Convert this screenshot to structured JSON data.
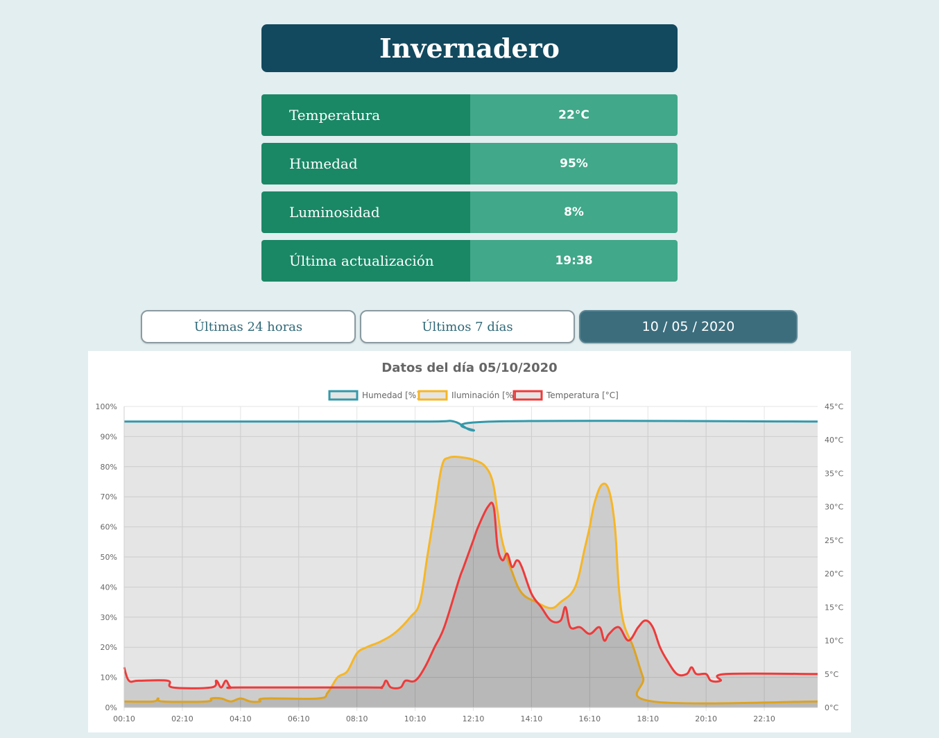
{
  "header": {
    "title": "Invernadero"
  },
  "stats": [
    {
      "label": "Temperatura",
      "value": "22°C"
    },
    {
      "label": "Humedad",
      "value": "95%"
    },
    {
      "label": "Luminosidad",
      "value": "8%"
    },
    {
      "label": "Última actualización",
      "value": "19:38"
    }
  ],
  "range_buttons": {
    "last_24h": "Últimas 24 horas",
    "last_7d": "Últimos 7 días",
    "date": "10 / 05 / 2020"
  },
  "colors": {
    "humidity": "#3399aa",
    "illumination": "#f6b626",
    "temperature": "#ee3a3a"
  },
  "chart_data": {
    "type": "line",
    "title": "Datos del día 05/10/2020",
    "legend_position": "top",
    "grid": true,
    "x_ticks": [
      "00:10",
      "02:10",
      "04:10",
      "06:10",
      "08:10",
      "10:10",
      "12:10",
      "14:10",
      "16:10",
      "18:10",
      "20:10",
      "22:10"
    ],
    "y_left": {
      "ticks": [
        "0%",
        "10%",
        "20%",
        "30%",
        "40%",
        "50%",
        "60%",
        "70%",
        "80%",
        "90%",
        "100%"
      ],
      "range": [
        0,
        100
      ]
    },
    "y_right": {
      "ticks": [
        "0°C",
        "5°C",
        "10°C",
        "15°C",
        "20°C",
        "25°C",
        "30°C",
        "35°C",
        "40°C",
        "45°C"
      ],
      "range": [
        0,
        45
      ]
    },
    "series": [
      {
        "name": "Humedad [%]",
        "axis": "left",
        "points": [
          [
            0,
            95
          ],
          [
            360,
            95
          ],
          [
            630,
            95
          ],
          [
            680,
            95
          ],
          [
            720,
            92
          ],
          [
            760,
            95
          ],
          [
            1430,
            95
          ]
        ]
      },
      {
        "name": "Iluminación [%]",
        "axis": "left",
        "points": [
          [
            0,
            2
          ],
          [
            60,
            2
          ],
          [
            70,
            3
          ],
          [
            80,
            2
          ],
          [
            170,
            2
          ],
          [
            180,
            3
          ],
          [
            200,
            3
          ],
          [
            220,
            2
          ],
          [
            240,
            3
          ],
          [
            260,
            2
          ],
          [
            280,
            2
          ],
          [
            290,
            3
          ],
          [
            400,
            3
          ],
          [
            420,
            5
          ],
          [
            440,
            10
          ],
          [
            460,
            12
          ],
          [
            480,
            18
          ],
          [
            500,
            20
          ],
          [
            530,
            22
          ],
          [
            560,
            25
          ],
          [
            590,
            30
          ],
          [
            610,
            35
          ],
          [
            625,
            50
          ],
          [
            640,
            65
          ],
          [
            655,
            80
          ],
          [
            670,
            83
          ],
          [
            700,
            83
          ],
          [
            725,
            82
          ],
          [
            745,
            80
          ],
          [
            760,
            75
          ],
          [
            770,
            65
          ],
          [
            780,
            55
          ],
          [
            800,
            45
          ],
          [
            820,
            38
          ],
          [
            850,
            35
          ],
          [
            880,
            33
          ],
          [
            900,
            35
          ],
          [
            930,
            40
          ],
          [
            950,
            53
          ],
          [
            960,
            60
          ],
          [
            970,
            68
          ],
          [
            985,
            74
          ],
          [
            1000,
            72
          ],
          [
            1012,
            60
          ],
          [
            1020,
            40
          ],
          [
            1030,
            28
          ],
          [
            1050,
            20
          ],
          [
            1070,
            10
          ],
          [
            1090,
            2
          ],
          [
            1430,
            2
          ]
        ]
      },
      {
        "name": "Temperatura [°C]",
        "axis": "right",
        "points": [
          [
            0,
            6
          ],
          [
            10,
            4
          ],
          [
            30,
            4
          ],
          [
            90,
            4
          ],
          [
            100,
            3
          ],
          [
            180,
            3
          ],
          [
            190,
            4
          ],
          [
            200,
            3
          ],
          [
            210,
            4
          ],
          [
            220,
            3
          ],
          [
            240,
            3
          ],
          [
            500,
            3
          ],
          [
            530,
            3
          ],
          [
            540,
            4
          ],
          [
            550,
            3
          ],
          [
            570,
            3
          ],
          [
            580,
            4
          ],
          [
            600,
            4
          ],
          [
            620,
            6
          ],
          [
            640,
            9
          ],
          [
            660,
            12
          ],
          [
            690,
            19
          ],
          [
            700,
            21
          ],
          [
            720,
            25
          ],
          [
            730,
            27
          ],
          [
            750,
            30
          ],
          [
            762,
            30
          ],
          [
            770,
            24
          ],
          [
            780,
            22
          ],
          [
            790,
            23
          ],
          [
            800,
            21
          ],
          [
            810,
            22
          ],
          [
            820,
            21
          ],
          [
            840,
            17
          ],
          [
            860,
            15
          ],
          [
            880,
            13
          ],
          [
            900,
            13
          ],
          [
            910,
            15
          ],
          [
            920,
            12
          ],
          [
            940,
            12
          ],
          [
            960,
            11
          ],
          [
            980,
            12
          ],
          [
            990,
            10
          ],
          [
            1000,
            11
          ],
          [
            1020,
            12
          ],
          [
            1040,
            10
          ],
          [
            1060,
            12
          ],
          [
            1075,
            13
          ],
          [
            1090,
            12
          ],
          [
            1105,
            9
          ],
          [
            1120,
            7
          ],
          [
            1140,
            5
          ],
          [
            1160,
            5
          ],
          [
            1170,
            6
          ],
          [
            1180,
            5
          ],
          [
            1200,
            5
          ],
          [
            1210,
            4
          ],
          [
            1230,
            4
          ],
          [
            1240,
            5
          ],
          [
            1430,
            5
          ]
        ]
      }
    ]
  }
}
